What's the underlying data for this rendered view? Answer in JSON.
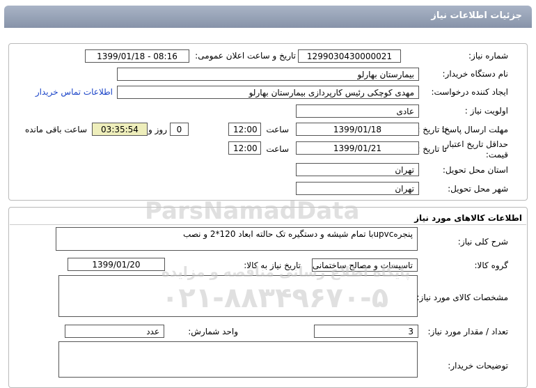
{
  "header": {
    "title": "جزئیات اطلاعات نیاز"
  },
  "need_info": {
    "need_number_label": "شماره نیاز:",
    "need_number": "1299030430000021",
    "announce_label": "تاریخ و ساعت اعلان عمومی:",
    "announce_value": "1399/01/18 - 08:16",
    "buyer_org_label": "نام دستگاه خریدار:",
    "buyer_org": "بیمارستان بهارلو",
    "requester_label": "ایجاد کننده درخواست:",
    "requester": "مهدی کوچکی  رئیس کارپردازی بیمارستان بهارلو",
    "contact_link": "اطلاعات تماس خریدار",
    "priority_label": "اولویت نیاز :",
    "priority": "عادی",
    "reply_deadline_label": "مهلت ارسال پاسخ:",
    "to_date_label": "تا تاریخ :",
    "reply_date": "1399/01/18",
    "time_label": "ساعت",
    "reply_time": "12:00",
    "days_value": "0",
    "days_label": "روز و",
    "remaining_time": "03:35:54",
    "remaining_label": "ساعت باقی مانده",
    "validity_label": "حداقل تاریخ اعتبار قیمت:",
    "validity_to_label": "تا تاریخ :",
    "validity_date": "1399/01/21",
    "validity_time_label": "ساعت",
    "validity_time": "12:00",
    "province_label": "استان محل تحویل:",
    "province": "تهران",
    "city_label": "شهر محل تحویل:",
    "city": "تهران"
  },
  "goods": {
    "section_title": "اطلاعات کالاهای مورد نیاز",
    "summary_label": "شرح کلی نیاز:",
    "summary": "پنجرهupvcبا تمام شیشه و دستگیره تک حالته ابعاد 120*2 و نصب",
    "group_label": "گروه کالا:",
    "group": "تاسیسات و مصالح ساختمانی",
    "need_date_label": "تاریخ نیاز به کالا:",
    "need_date": "1399/01/20",
    "specs_label": "مشخصات کالای مورد نیاز:",
    "specs": "",
    "qty_label": "تعداد / مقدار مورد نیاز:",
    "qty": "3",
    "unit_label": "واحد شمارش:",
    "unit": "عدد",
    "buyer_notes_label": "توضیحات خریدار:",
    "buyer_notes": ""
  },
  "watermark": {
    "brand": "ParsNamadData",
    "tagline": "پایگاه اطلاع رسانی مناقصه و مزایده",
    "phone": "۰۲۱-۸۸۳۴۹۶۷۰-۵"
  }
}
